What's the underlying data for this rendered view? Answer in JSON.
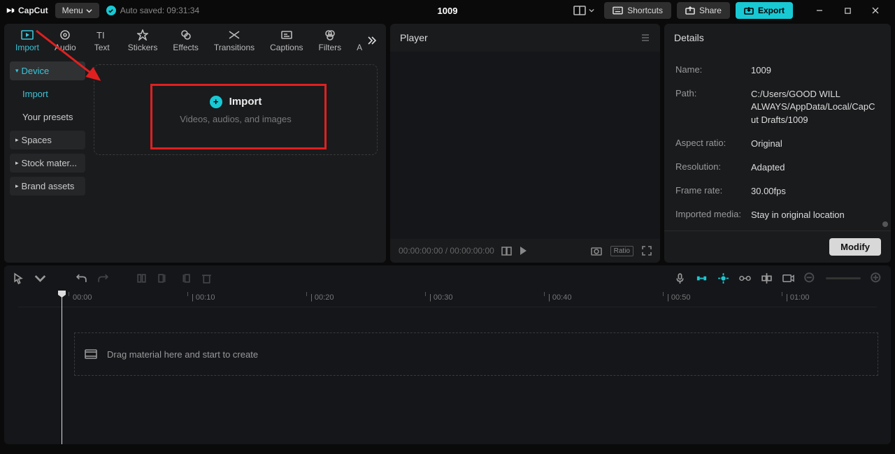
{
  "header": {
    "app_name": "CapCut",
    "menu_label": "Menu",
    "autosave_text": "Auto saved: 09:31:34",
    "title": "1009",
    "shortcuts_label": "Shortcuts",
    "share_label": "Share",
    "export_label": "Export"
  },
  "tabs": [
    {
      "label": "Import",
      "icon": "import"
    },
    {
      "label": "Audio",
      "icon": "audio"
    },
    {
      "label": "Text",
      "icon": "text"
    },
    {
      "label": "Stickers",
      "icon": "stickers"
    },
    {
      "label": "Effects",
      "icon": "effects"
    },
    {
      "label": "Transitions",
      "icon": "transitions"
    },
    {
      "label": "Captions",
      "icon": "captions"
    },
    {
      "label": "Filters",
      "icon": "filters"
    },
    {
      "label": "Adjus",
      "icon": "adjust"
    }
  ],
  "sidebar": {
    "device": "Device",
    "import": "Import",
    "presets": "Your presets",
    "spaces": "Spaces",
    "stock": "Stock mater...",
    "brand": "Brand assets"
  },
  "dropzone": {
    "title": "Import",
    "subtitle": "Videos, audios, and images"
  },
  "player": {
    "title": "Player",
    "time": "00:00:00:00  /  00:00:00:00",
    "ratio_label": "Ratio"
  },
  "details": {
    "title": "Details",
    "rows": {
      "name": {
        "label": "Name:",
        "value": "1009"
      },
      "path": {
        "label": "Path:",
        "value": "C:/Users/GOOD WILL ALWAYS/AppData/Local/CapCut Drafts/1009"
      },
      "aspect": {
        "label": "Aspect ratio:",
        "value": "Original"
      },
      "resolution": {
        "label": "Resolution:",
        "value": "Adapted"
      },
      "framerate": {
        "label": "Frame rate:",
        "value": "30.00fps"
      },
      "imported": {
        "label": "Imported media:",
        "value": "Stay in original location"
      }
    },
    "modify": "Modify"
  },
  "timeline": {
    "ticks": [
      "00:00",
      "| 00:10",
      "| 00:20",
      "| 00:30",
      "| 00:40",
      "| 00:50",
      "| 01:00"
    ],
    "drag_hint": "Drag material here and start to create"
  }
}
